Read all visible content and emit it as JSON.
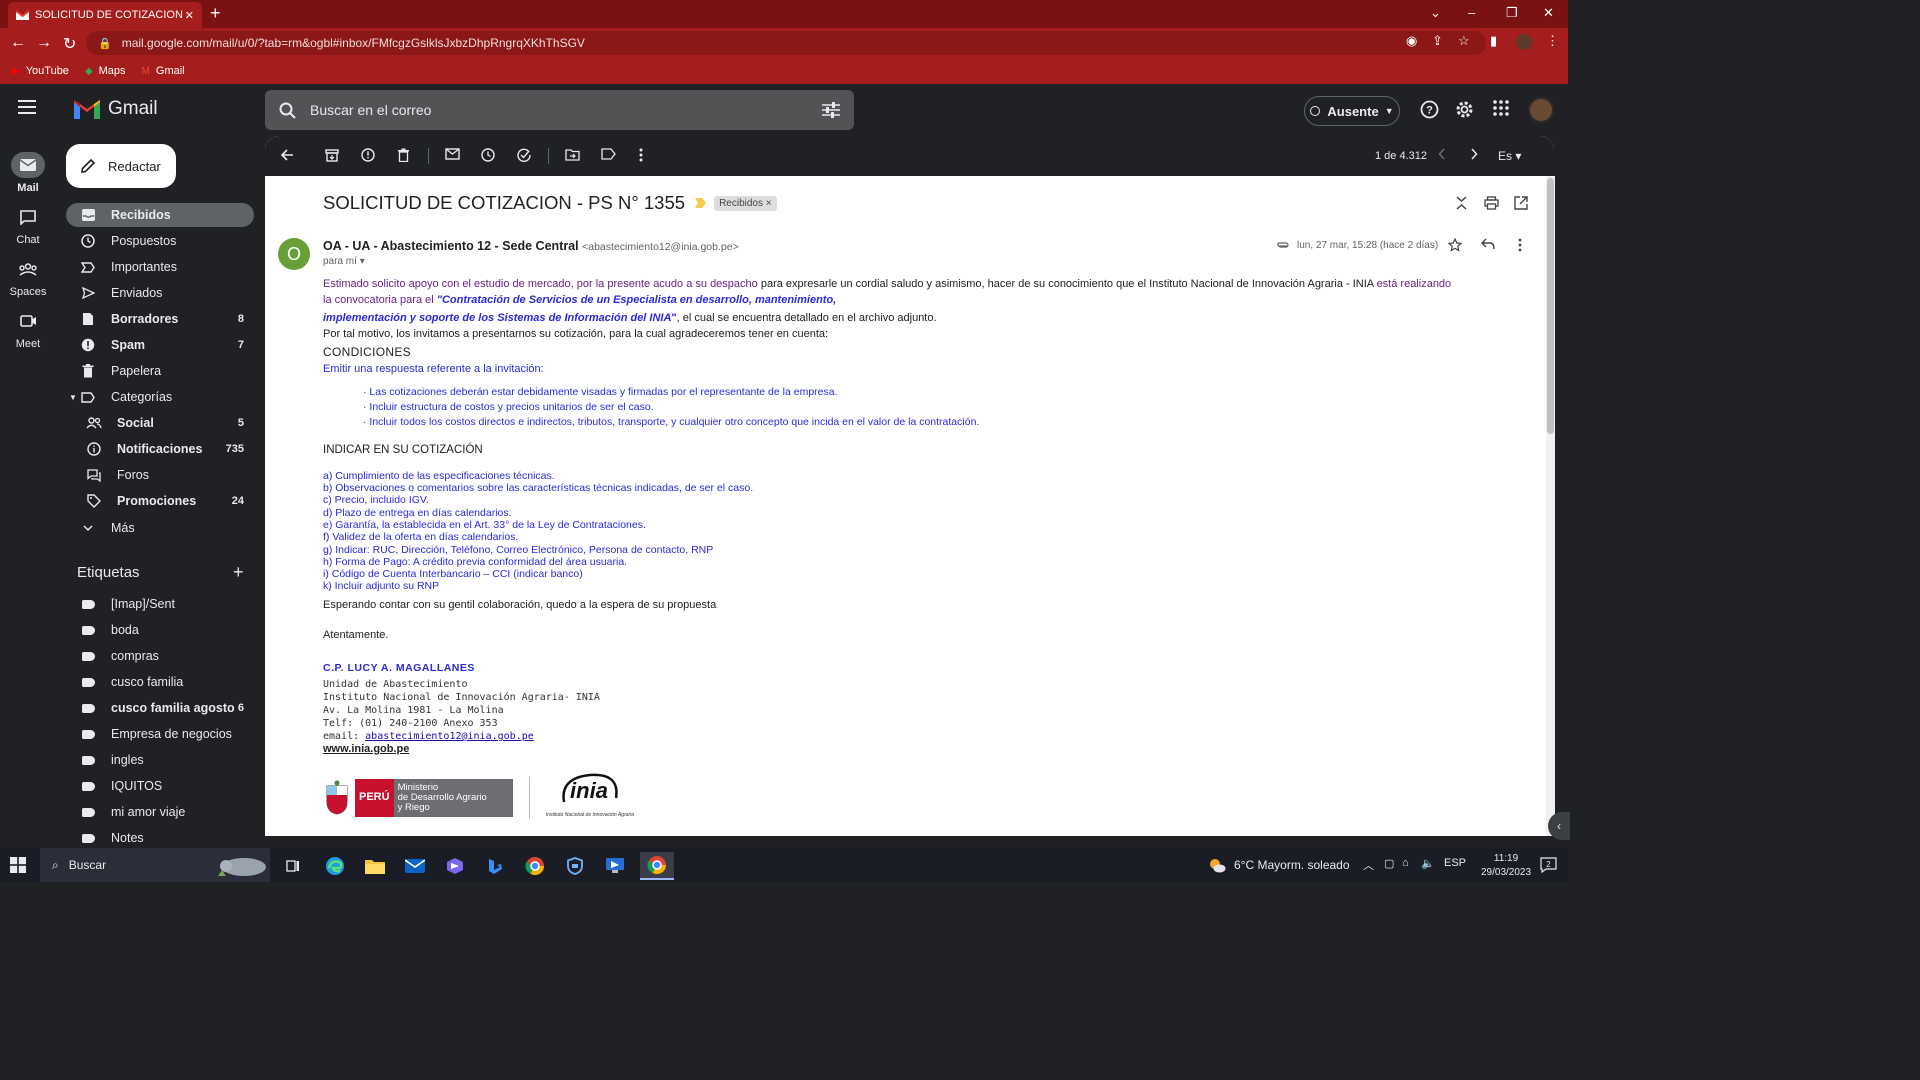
{
  "browser": {
    "tab_title": "SOLICITUD DE COTIZACION - PS",
    "url": "mail.google.com/mail/u/0/?tab=rm&ogbl#inbox/FMfcgzGslklsJxbzDhpRngrqXKhThSGV",
    "bookmarks": [
      "YouTube",
      "Maps",
      "Gmail"
    ],
    "accent_color": "#a51d1d"
  },
  "header": {
    "app_name": "Gmail",
    "search_placeholder": "Buscar en el correo",
    "status_label": "Ausente"
  },
  "rail": [
    {
      "label": "Mail",
      "icon": "mail-icon"
    },
    {
      "label": "Chat",
      "icon": "chat-icon"
    },
    {
      "label": "Spaces",
      "icon": "spaces-icon"
    },
    {
      "label": "Meet",
      "icon": "meet-icon"
    }
  ],
  "sidebar": {
    "compose_label": "Redactar",
    "items": [
      {
        "label": "Recibidos",
        "count": "",
        "icon": "inbox-icon"
      },
      {
        "label": "Pospuestos",
        "count": "",
        "icon": "clock-icon"
      },
      {
        "label": "Importantes",
        "count": "",
        "icon": "important-icon"
      },
      {
        "label": "Enviados",
        "count": "",
        "icon": "send-icon"
      },
      {
        "label": "Borradores",
        "count": "8",
        "icon": "draft-icon"
      },
      {
        "label": "Spam",
        "count": "7",
        "icon": "spam-icon"
      },
      {
        "label": "Papelera",
        "count": "",
        "icon": "trash-icon"
      },
      {
        "label": "Categorías",
        "count": "",
        "icon": "category-icon"
      },
      {
        "label": "Social",
        "count": "5",
        "icon": "people-icon"
      },
      {
        "label": "Notificaciones",
        "count": "735",
        "icon": "info-icon"
      },
      {
        "label": "Foros",
        "count": "",
        "icon": "forum-icon"
      },
      {
        "label": "Promociones",
        "count": "24",
        "icon": "tag-icon"
      },
      {
        "label": "Más",
        "count": "",
        "icon": "chevron-down-icon"
      }
    ],
    "labels_title": "Etiquetas",
    "labels": [
      {
        "label": "[Imap]/Sent",
        "count": ""
      },
      {
        "label": "boda",
        "count": ""
      },
      {
        "label": "compras",
        "count": ""
      },
      {
        "label": "cusco familia",
        "count": ""
      },
      {
        "label": "cusco familia agosto",
        "count": "6"
      },
      {
        "label": "Empresa de negocios",
        "count": ""
      },
      {
        "label": "ingles",
        "count": ""
      },
      {
        "label": "IQUITOS",
        "count": ""
      },
      {
        "label": "mi amor viaje",
        "count": ""
      },
      {
        "label": "Notes",
        "count": ""
      }
    ]
  },
  "toolbar": {
    "pager": "1 de 4.312",
    "lang": "Es"
  },
  "message": {
    "subject": "SOLICITUD DE COTIZACION - PS N° 1355",
    "label_chip": "Recibidos",
    "sender_initial": "O",
    "sender_name": "OA - UA - Abastecimiento 12 - Sede Central",
    "sender_email": "<abastecimiento12@inia.gob.pe>",
    "to": "para mí",
    "date": "lun, 27 mar, 15:28 (hace 2 días)",
    "body": {
      "p1_a": "Estimado solicito apoyo con el estudio de mercado, por la presente acudo a su despacho",
      "p1_b": " para expresarle un cordial saludo y asimismo, hacer de su conocimiento que el Instituto Nacional de Innovación Agraria - INIA ",
      "p1_c": " está realizando",
      "p2_a": "la convocatoria para el ",
      "p2_b": "\"Contratación de Servicios de un Especialista en desarrollo, mantenimiento,",
      "p3_a": "implementación y soporte de los Sistemas de Información del INIA",
      "p3_b": "\"",
      "p3_c": ", el cual se encuentra detallado en el archivo adjunto.",
      "p4": "Por tal motivo, los invitamos a presentarnos su cotización, para la cual agradeceremos tener en cuenta:",
      "condiciones": "CONDICIONES",
      "emitir": "Emitir una respuesta referente a la invitación:",
      "bullets": [
        "· Las cotizaciones deberán estar debidamente visadas y firmadas por el representante de la empresa.",
        "· Incluir estructura de costos y precios unitarios de ser el caso.",
        "· Incluir todos los costos directos e indirectos, tributos, transporte, y cualquier otro concepto que incida en el valor de la contratación."
      ],
      "indicar_title": "INDICAR EN SU COTIZACIÓN",
      "indicar": [
        "a) Cumplimiento de las especificaciones técnicas.",
        "b) Observaciones o comentarios sobre las características técnicas indicadas, de ser el caso.",
        "c) Precio, incluido IGV.",
        "d) Plazo de entrega en días calendarios.",
        "e) Garantía, la establecida en el Art. 33° de la Ley de Contrataciones.",
        "f) Validez de la oferta en días calendarios.",
        "g) Indicar: RUC, Dirección, Teléfono, Correo Electrónico, Persona de contacto, RNP",
        "h) Forma de Pago: A crédito previa conformidad del área usuaria.",
        "i) Código de Cuenta Interbancario – CCI (indicar banco)",
        "k) Incluir adjunto su RNP"
      ],
      "esperando": "Esperando contar con su gentil colaboración, quedo a la espera de su propuesta",
      "atentamente": "Atentamente."
    },
    "signature": {
      "name": "C.P. LUCY A. MAGALLANES",
      "lines": [
        "Unidad de Abastecimiento",
        "Instituto Nacional de Innovación Agraria-  INIA",
        "Av. La Molina 1981 - La Molina",
        "Telf: (01) 240-2100 Anexo 353"
      ],
      "email_prefix": "email: ",
      "email": "abastecimiento12@inia.gob.pe",
      "web": "www.inia.gob.pe",
      "peru": "PERÚ",
      "ministerio_1": "Ministerio",
      "ministerio_2": "de Desarrollo Agrario",
      "ministerio_3": "y Riego",
      "inia": "inia",
      "inia_sub": "Instituto Nacional de Innovación Agraria"
    }
  },
  "taskbar": {
    "search_label": "Buscar",
    "weather": "6°C  Mayorm. soleado",
    "lang": "ESP",
    "time": "11:19",
    "date": "29/03/2023",
    "notif_count": "2"
  }
}
